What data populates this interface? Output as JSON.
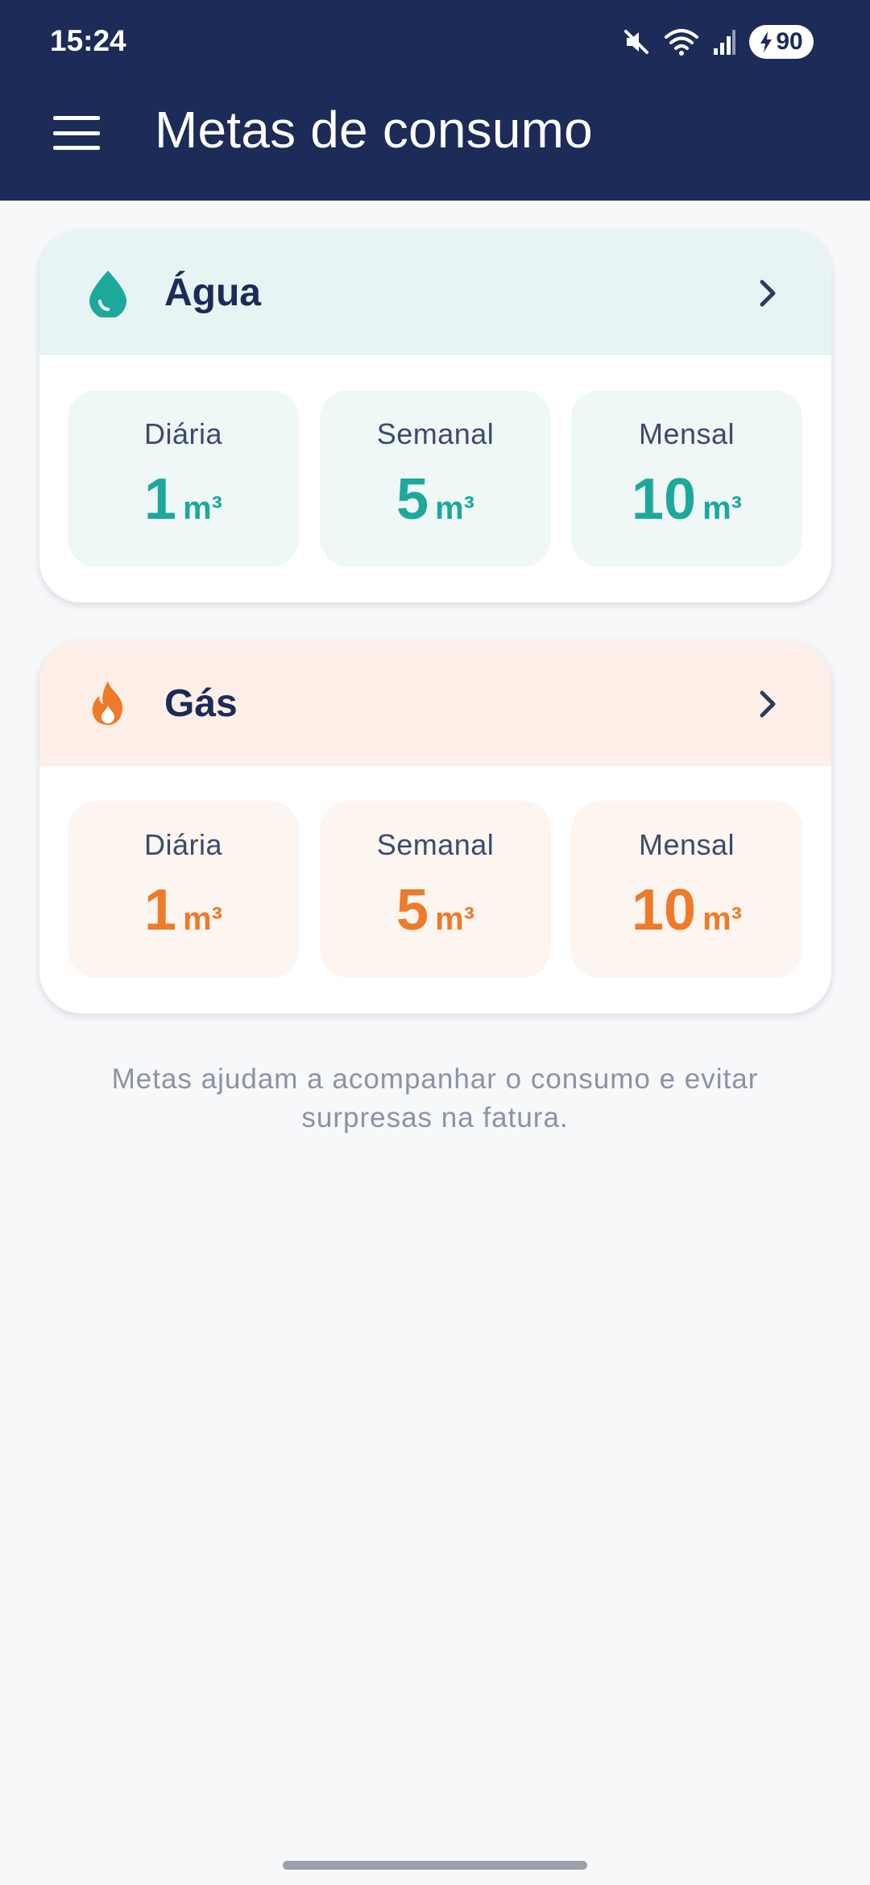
{
  "status_bar": {
    "time": "15:24",
    "battery_level": "90",
    "icons": [
      "mute-icon",
      "wifi-icon",
      "signal-icon",
      "battery-charging-icon"
    ]
  },
  "app_bar": {
    "menu_icon": "hamburger-menu-icon",
    "title": "Metas de consumo",
    "background_color": "#1c2b57"
  },
  "cards": [
    {
      "id": "agua",
      "title": "Água",
      "icon": "water-drop-icon",
      "accent_color": "#1da89c",
      "goals": [
        {
          "label": "Diária",
          "value": "1",
          "unit": "m³"
        },
        {
          "label": "Semanal",
          "value": "5",
          "unit": "m³"
        },
        {
          "label": "Mensal",
          "value": "10",
          "unit": "m³"
        }
      ]
    },
    {
      "id": "gas",
      "title": "Gás",
      "icon": "flame-icon",
      "accent_color": "#ee7a2a",
      "goals": [
        {
          "label": "Diária",
          "value": "1",
          "unit": "m³"
        },
        {
          "label": "Semanal",
          "value": "5",
          "unit": "m³"
        },
        {
          "label": "Mensal",
          "value": "10",
          "unit": "m³"
        }
      ]
    }
  ],
  "footnote": "Metas ajudam a acompanhar o consumo e evitar surpresas na fatura."
}
